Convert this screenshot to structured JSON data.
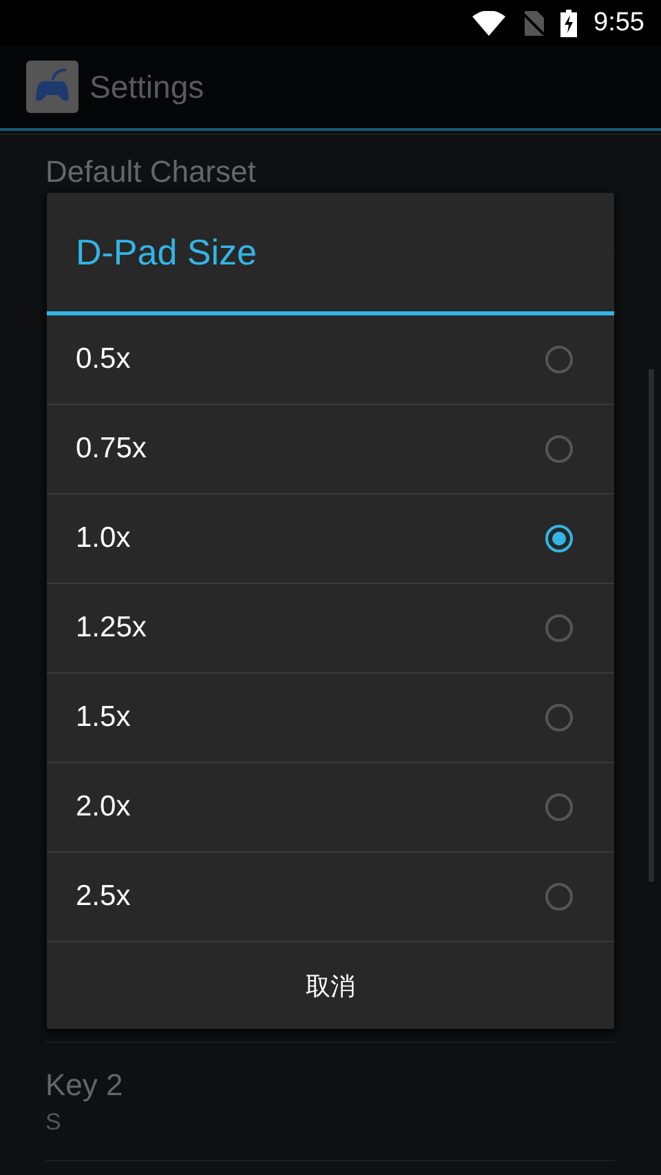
{
  "status_bar": {
    "time": "9:55"
  },
  "app_bar": {
    "title": "Settings"
  },
  "settings": [
    {
      "title": "Default Charset"
    },
    {
      "title": "Key 2",
      "summary": "S"
    }
  ],
  "dialog": {
    "title": "D-Pad Size",
    "options": [
      {
        "label": "0.5x",
        "selected": false
      },
      {
        "label": "0.75x",
        "selected": false
      },
      {
        "label": "1.0x",
        "selected": true
      },
      {
        "label": "1.25x",
        "selected": false
      },
      {
        "label": "1.5x",
        "selected": false
      },
      {
        "label": "2.0x",
        "selected": false
      },
      {
        "label": "2.5x",
        "selected": false
      }
    ],
    "cancel": "取消"
  }
}
